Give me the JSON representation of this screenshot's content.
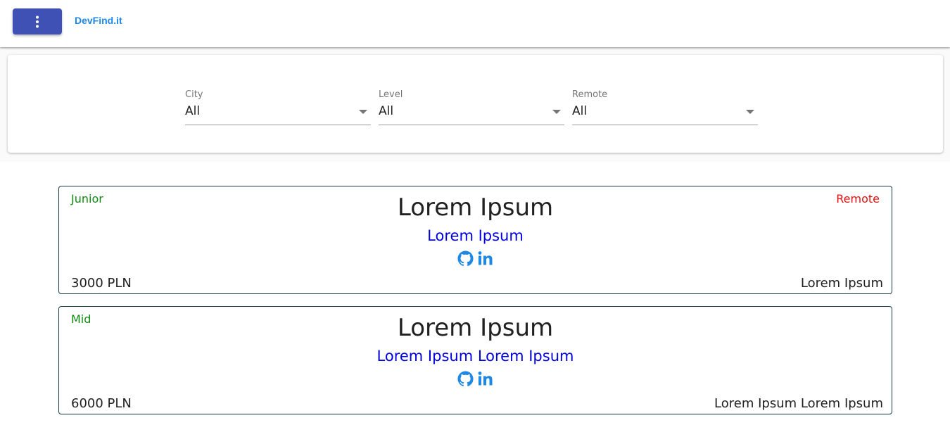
{
  "header": {
    "brand": "DevFind.it",
    "menu_icon": "more-vert-icon",
    "accent_color": "#3f51b5",
    "brand_color": "#1e88e5"
  },
  "filters": [
    {
      "label": "City",
      "value": "All"
    },
    {
      "label": "Level",
      "value": "All"
    },
    {
      "label": "Remote",
      "value": "All"
    }
  ],
  "jobs": [
    {
      "level": "Junior",
      "remote": "Remote",
      "title": "Lorem Ipsum",
      "company": "Lorem Ipsum",
      "icons": [
        "github-icon",
        "linkedin-icon"
      ],
      "salary": "3000 PLN",
      "location": "Lorem Ipsum"
    },
    {
      "level": "Mid",
      "remote": "",
      "title": "Lorem Ipsum",
      "company": "Lorem Ipsum Lorem Ipsum",
      "icons": [
        "github-icon",
        "linkedin-icon"
      ],
      "salary": "6000 PLN",
      "location": "Lorem Ipsum Lorem Ipsum"
    }
  ],
  "colors": {
    "level": "#108a10",
    "remote": "#e01010",
    "company": "#0000dd",
    "icon": "#1e88e5"
  }
}
